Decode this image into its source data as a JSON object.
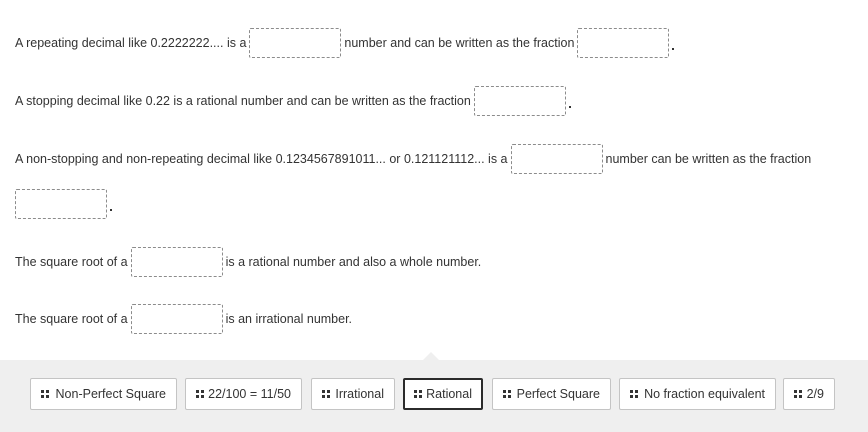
{
  "questions": {
    "q1": {
      "text_before": "A repeating decimal like 0.2222222.... is a",
      "text_middle": "number and can be written as the fraction"
    },
    "q2": {
      "text_before": "A stopping decimal like 0.22 is a rational number and can be written as the fraction"
    },
    "q3": {
      "text_before": "A non-stopping and non-repeating decimal like 0.1234567891011... or 0.121121112... is a",
      "text_middle": "number can be written as the fraction"
    },
    "q4": {
      "text_before": "The square root of a",
      "text_after": "is a rational number and also a whole number."
    },
    "q5": {
      "text_before": "The square root of a",
      "text_after": "is an irrational number."
    }
  },
  "choices": [
    {
      "label": "Non-Perfect Square"
    },
    {
      "label": "22/100 = 11/50"
    },
    {
      "label": "Irrational"
    },
    {
      "label": "Rational",
      "selected": true
    },
    {
      "label": "Perfect Square"
    },
    {
      "label": "No fraction equivalent"
    },
    {
      "label": "2/9"
    }
  ]
}
